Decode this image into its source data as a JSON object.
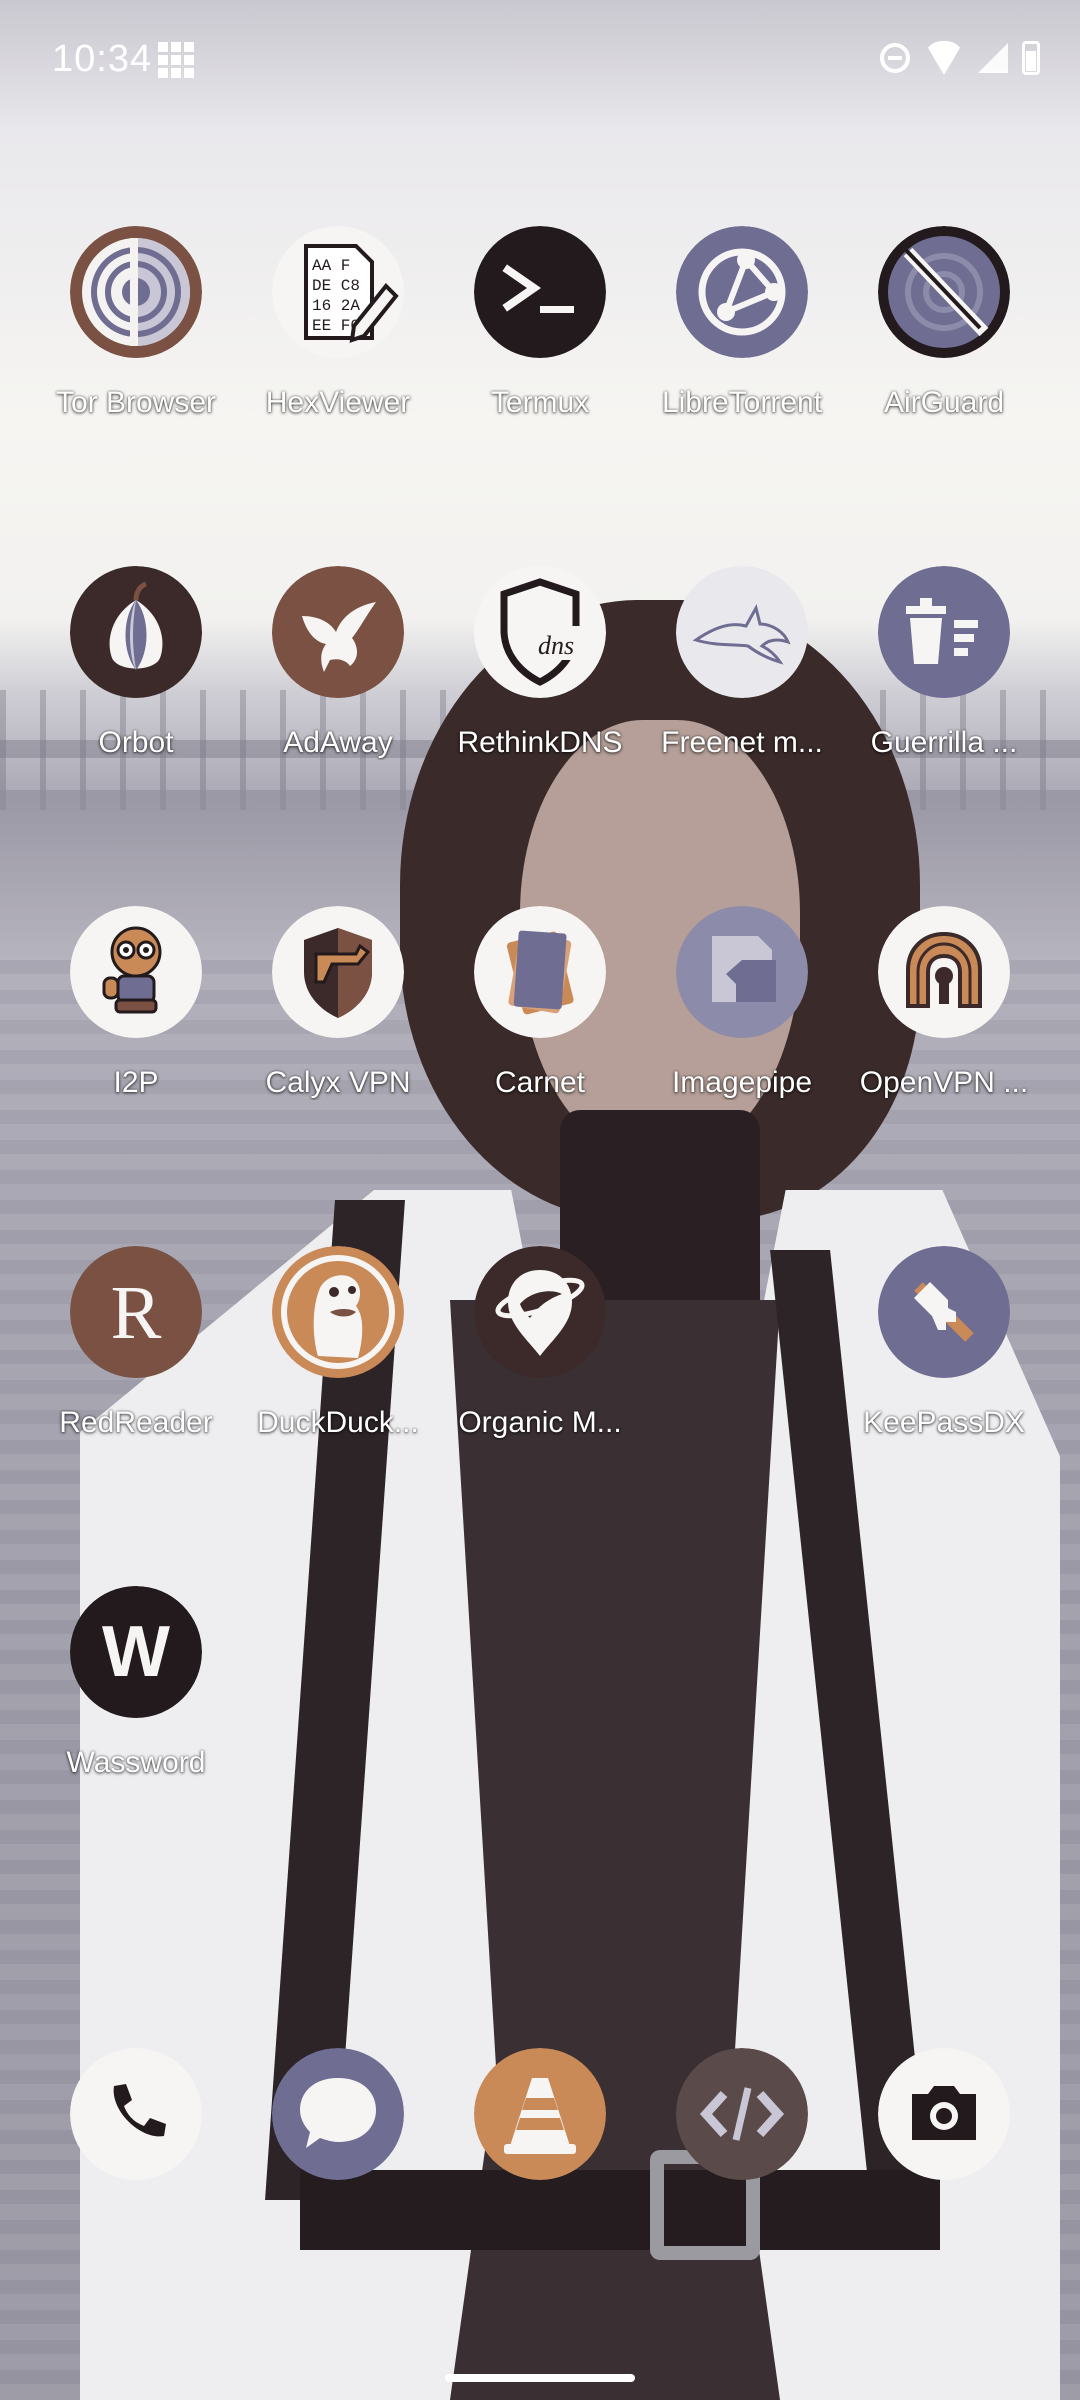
{
  "status_bar": {
    "time": "10:34",
    "icons": [
      "app-grid-notification-icon",
      "do-not-disturb-icon",
      "wifi-icon",
      "cellular-signal-icon",
      "battery-icon"
    ]
  },
  "apps": [
    {
      "label": "Tor Browser",
      "icon": "tor-browser-icon"
    },
    {
      "label": "HexViewer",
      "icon": "hexviewer-icon",
      "glyph_text": [
        "AA F",
        "DE C8",
        "16 2A",
        "EE F0"
      ]
    },
    {
      "label": "Termux",
      "icon": "termux-icon"
    },
    {
      "label": "LibreTorrent",
      "icon": "libretorrent-icon"
    },
    {
      "label": "AirGuard",
      "icon": "airguard-icon"
    },
    {
      "label": "Orbot",
      "icon": "orbot-icon"
    },
    {
      "label": "AdAway",
      "icon": "adaway-icon"
    },
    {
      "label": "RethinkDNS",
      "icon": "rethinkdns-icon",
      "glyph_text": "dns"
    },
    {
      "label": "Freenet m...",
      "icon": "freenet-icon"
    },
    {
      "label": "Guerrilla ...",
      "icon": "guerrilla-mail-icon"
    },
    {
      "label": "I2P",
      "icon": "i2p-icon"
    },
    {
      "label": "Calyx VPN",
      "icon": "calyx-vpn-icon"
    },
    {
      "label": "Carnet",
      "icon": "carnet-icon"
    },
    {
      "label": "Imagepipe",
      "icon": "imagepipe-icon"
    },
    {
      "label": "OpenVPN ...",
      "icon": "openvpn-icon"
    },
    {
      "label": "RedReader",
      "icon": "redreader-icon",
      "glyph_text": "R"
    },
    {
      "label": "DuckDuck...",
      "icon": "duckduckgo-icon"
    },
    {
      "label": "Organic M...",
      "icon": "organic-maps-icon"
    },
    {
      "label": "KeePassDX",
      "icon": "keepassdx-icon"
    },
    {
      "label": "Wassword",
      "icon": "wassword-icon",
      "glyph_text": "W"
    }
  ],
  "dock": [
    {
      "icon": "phone-icon"
    },
    {
      "icon": "messaging-icon"
    },
    {
      "icon": "vlc-icon"
    },
    {
      "icon": "code-editor-icon"
    },
    {
      "icon": "camera-icon"
    }
  ],
  "colors": {
    "accent_purple": "#6f6d92",
    "accent_brown": "#7a5142",
    "accent_orange": "#c98a58",
    "dark": "#231a1d",
    "light": "#f6f5f3"
  }
}
